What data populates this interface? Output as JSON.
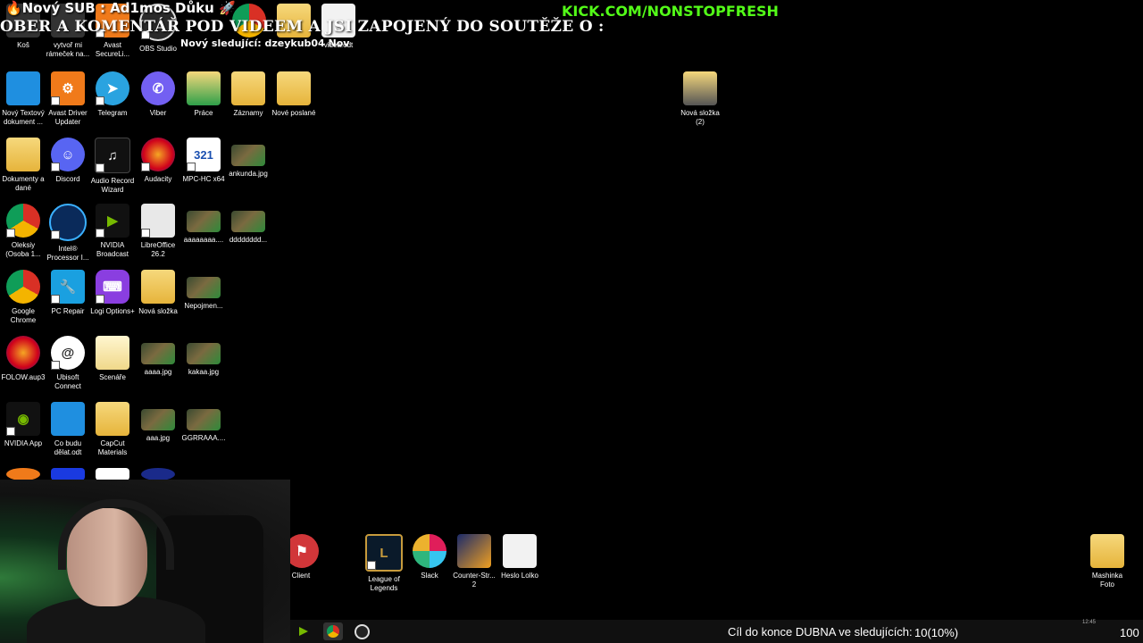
{
  "overlays": {
    "sub_alert": "🔥Nový SUB : Ad1mos Důku 🚀",
    "ticker": "OBER A KOMENTÁŘ POD VIDEEM A JSI ZAPOJENÝ DO SOUTĚŽE O :",
    "follower": "Nový sledující: dzeykub04    Nov",
    "kick_url": "KICK.COM/NONSTOPFRESH"
  },
  "icons": {
    "kos": "Koš",
    "vytvor": "vytvoř mi rámeček na...",
    "avast_secure": "Avast SecureLi...",
    "obs": "OBS Studio",
    "videa": "videa.odt",
    "novy_textovy": "Nový Textový dokument ...",
    "avast_driver": "Avast Driver Updater",
    "telegram": "Telegram",
    "viber": "Viber",
    "prace": "Práce",
    "zaznamy": "Záznamy",
    "nove_poslane": "Nové poslané",
    "nova_slozka_2": "Nová složka (2)",
    "dokumenty": "Dokumenty a dané",
    "discord": "Discord",
    "audio_record": "Audio Record Wizard",
    "audacity": "Audacity",
    "mpc": "MPC-HC x64",
    "ankunda": "ankunda.jpg",
    "oleksiy": "Oleksiy (Osoba 1...",
    "intel": "Intel® Processor I...",
    "nvidia_broadcast": "NVIDIA Broadcast",
    "libreoffice": "LibreOffice 26.2",
    "aaaaaaaa": "aaaaaaaa....",
    "dddddddd": "dddddddd...",
    "google_chrome": "Google Chrome",
    "pc_repair": "PC Repair",
    "logi": "Logi Options+",
    "nova_slozka": "Nová složka",
    "nepojmen": "Nepojmen...",
    "folow": "FOLOW.aup3",
    "ubisoft": "Ubisoft Connect",
    "scenare": "Scenáře",
    "aaaa_jpg": "aaaa.jpg",
    "kakaa": "kakaa.jpg",
    "nvidia_app": "NVIDIA App",
    "co_budu": "Co budu dělat.odt",
    "capcut": "CapCut Materials",
    "aaa_jpg": "aaa.jpg",
    "ggrraaa": "GGRRAAA....",
    "client": "Client",
    "league": "League of Legends",
    "slack": "Slack",
    "counter": "Counter-Str... 2",
    "heslo": "Heslo Lolko",
    "mashinka": "Mashinka Foto"
  },
  "taskbar": {
    "goal_text": "Cíl do konce DUBNA ve sledujících:",
    "goal_count": "10(10%)",
    "goal_target": "100",
    "goal_progress_percent": 10,
    "clock": "12:45"
  }
}
